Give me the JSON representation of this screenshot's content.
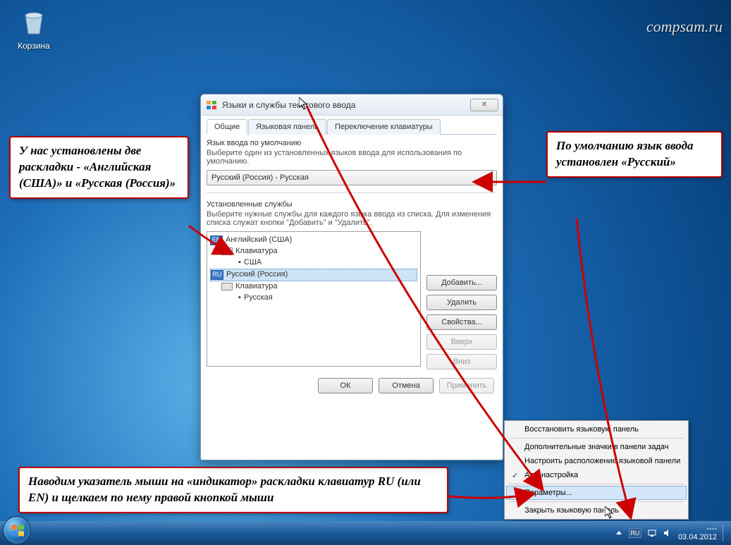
{
  "watermark": "compsam.ru",
  "desktop": {
    "recycle_label": "Корзина"
  },
  "callouts": {
    "left": "У нас установлены две раскладки - «Английская (США)» и «Русская (Россия)»",
    "right": "По умолчанию язык ввода установлен «Русский»",
    "bottom": "Наводим указатель мыши на «индикатор» раскладки клавиатур RU (или EN) и щелкаем по нему правой кнопкой мыши"
  },
  "dialog": {
    "title": "Языки и службы текстового ввода",
    "tabs": {
      "t1": "Общие",
      "t2": "Языковая панель",
      "t3": "Переключение клавиатуры"
    },
    "group1": {
      "label": "Язык ввода по умолчанию",
      "desc": "Выберите один из установленных языков ввода для использования по умолчанию.",
      "dropdown": "Русский (Россия) - Русская"
    },
    "group2": {
      "label": "Установленные службы",
      "desc": "Выберите нужные службы для каждого языка ввода из списка. Для изменения списка служат кнопки \"Добавить\" и \"Удалить\"."
    },
    "tree": {
      "en_badge": "EN",
      "en_lang": "Английский (США)",
      "kb_label": "Клавиатура",
      "en_kb": "США",
      "ru_badge": "RU",
      "ru_lang": "Русский (Россия)",
      "ru_kb": "Русская"
    },
    "buttons": {
      "add": "Добавить...",
      "remove": "Удалить",
      "props": "Свойства...",
      "up": "Вверх",
      "down": "Вниз",
      "ok": "ОК",
      "cancel": "Отмена",
      "apply": "Применить"
    }
  },
  "context_menu": {
    "restore": "Восстановить языковую панель",
    "extra": "Дополнительные значки в панели задач",
    "position": "Настроить расположение языковой панели",
    "auto": "Автонастройка",
    "params": "Параметры...",
    "close": "Закрыть языковую панель"
  },
  "taskbar": {
    "lang": "RU",
    "time": "----",
    "date": "03.04.2012"
  }
}
